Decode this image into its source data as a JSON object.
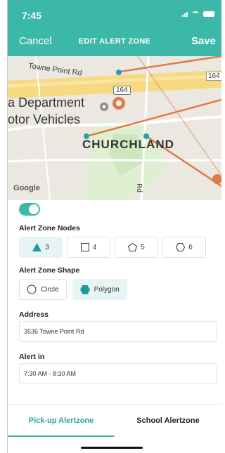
{
  "status_bar": {
    "time": "7:45"
  },
  "nav": {
    "cancel_label": "Cancel",
    "title": "EDIT ALERT ZONE",
    "save_label": "Save"
  },
  "map": {
    "street_label": "Towne Point Rd",
    "poi_label_line1": "a Department",
    "poi_label_line2": "otor Vehicles",
    "area_label": "CHURCHLAND",
    "route_shield": "164",
    "route_shield_right": "164",
    "road_label": "Rd",
    "attribution": "Google"
  },
  "toggle": {
    "state": "on"
  },
  "nodes": {
    "label": "Alert Zone Nodes",
    "options": [
      {
        "value": "3",
        "icon": "triangle-icon",
        "selected": true
      },
      {
        "value": "4",
        "icon": "square-icon",
        "selected": false
      },
      {
        "value": "5",
        "icon": "pentagon-icon",
        "selected": false
      },
      {
        "value": "6",
        "icon": "hexagon-icon",
        "selected": false
      }
    ]
  },
  "shape": {
    "label": "Alert Zone Shape",
    "options": [
      {
        "label": "Circle",
        "icon": "circle-icon",
        "selected": false
      },
      {
        "label": "Polygon",
        "icon": "hexagon-icon",
        "selected": true
      }
    ]
  },
  "address": {
    "label": "Address",
    "value": "3536 Towne Point Rd"
  },
  "alert_in": {
    "label": "Alert in",
    "value": "7:30 AM - 8:30 AM"
  },
  "tabs": {
    "pickup": "Pick-up Alertzone",
    "school": "School Alertzone",
    "active": "pickup"
  },
  "colors": {
    "accent": "#3bb8a8",
    "route": "#e07a45",
    "selected_bg": "#e6f4f4"
  }
}
